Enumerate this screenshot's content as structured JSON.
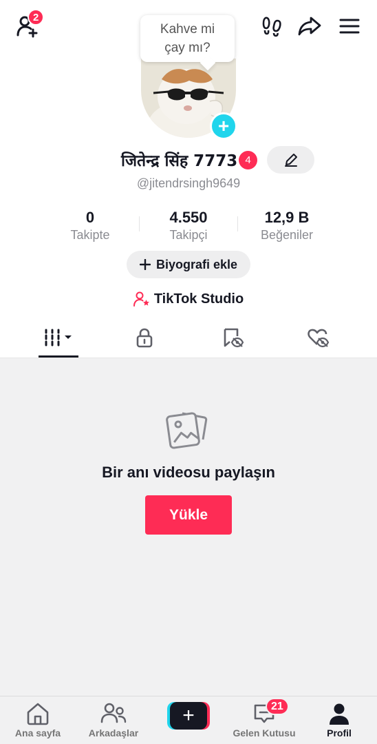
{
  "topbar": {
    "add_friends_badge": "2",
    "icons": [
      "add-friend-icon",
      "footprints-icon",
      "share-icon",
      "menu-icon"
    ]
  },
  "profile": {
    "note_bubble": "Kahve mi\nçay mı?",
    "name": "जितेन्द्र सिंह 7773",
    "name_badge": "4",
    "handle": "@jitendrsingh9649",
    "stats": [
      {
        "value": "0",
        "label": "Takipte"
      },
      {
        "value": "4.550",
        "label": "Takipçi"
      },
      {
        "value": "12,9 B",
        "label": "Beğeniler"
      }
    ],
    "bio_button": "Biyografi ekle",
    "studio_link": "TikTok Studio"
  },
  "tabs": [
    {
      "icon": "videos-grid-icon",
      "active": true
    },
    {
      "icon": "lock-icon",
      "active": false
    },
    {
      "icon": "bookmark-hidden-icon",
      "active": false
    },
    {
      "icon": "liked-hidden-icon",
      "active": false
    }
  ],
  "empty_state": {
    "title": "Bir anı videosu paylaşın",
    "upload_button": "Yükle"
  },
  "bottom_nav": {
    "items": [
      {
        "label": "Ana sayfa",
        "icon": "home-icon"
      },
      {
        "label": "Arkadaşlar",
        "icon": "friends-icon"
      },
      {
        "label": "",
        "icon": "create-icon"
      },
      {
        "label": "Gelen Kutusu",
        "icon": "inbox-icon",
        "badge": "21"
      },
      {
        "label": "Profil",
        "icon": "profile-icon",
        "active": true
      }
    ]
  },
  "colors": {
    "accent": "#fe2c55",
    "cyan": "#20d5ec",
    "text": "#161823",
    "muted": "#8a8b91"
  }
}
